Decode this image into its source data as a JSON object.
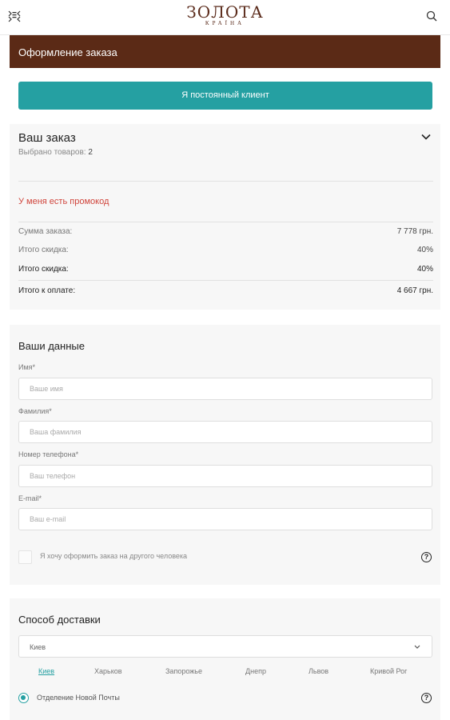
{
  "header": {
    "logo_main": "ЗОЛОТА",
    "logo_sub": "КРАЇНА",
    "menu_icon": "menu-icon",
    "search_icon": "search-icon"
  },
  "banner": {
    "title": "Оформление заказа"
  },
  "regular_client_button": "Я постоянный клиент",
  "order": {
    "title": "Ваш заказ",
    "selected_label": "Выбрано товаров:",
    "selected_count": "2",
    "promo_link": "У меня есть промокод",
    "rows": [
      {
        "label": "Сумма заказа:",
        "value": "7 778 грн."
      },
      {
        "label": "Итого скидка:",
        "value": "40%"
      },
      {
        "label": "Итого скидка:",
        "value": "40%"
      },
      {
        "label": "Итого к оплате:",
        "value": "4 667 грн."
      }
    ]
  },
  "your_data": {
    "title": "Ваши данные",
    "fields": [
      {
        "label": "Имя*",
        "placeholder": "Ваше имя",
        "value": ""
      },
      {
        "label": "Фамилия*",
        "placeholder": "Ваша фамилия",
        "value": ""
      },
      {
        "label": "Номер телефона*",
        "placeholder": "Ваш телефон",
        "value": ""
      },
      {
        "label": "E-mail*",
        "placeholder": "Ваш e-mail",
        "value": ""
      }
    ],
    "other_person_checkbox": "Я хочу оформить заказ на другого человека",
    "other_person_checked": false
  },
  "delivery": {
    "title": "Способ доставки",
    "city_selected": "Киев",
    "cities": [
      "Киев",
      "Харьков",
      "Запорожье",
      "Днепр",
      "Львов",
      "Кривой Рог"
    ],
    "active_city": "Киев",
    "method": "Отделение Новой Почты",
    "method_selected": true
  },
  "colors": {
    "brand_brown": "#5b2a16",
    "accent_teal": "#25a0a2",
    "promo_red": "#d0453c"
  }
}
